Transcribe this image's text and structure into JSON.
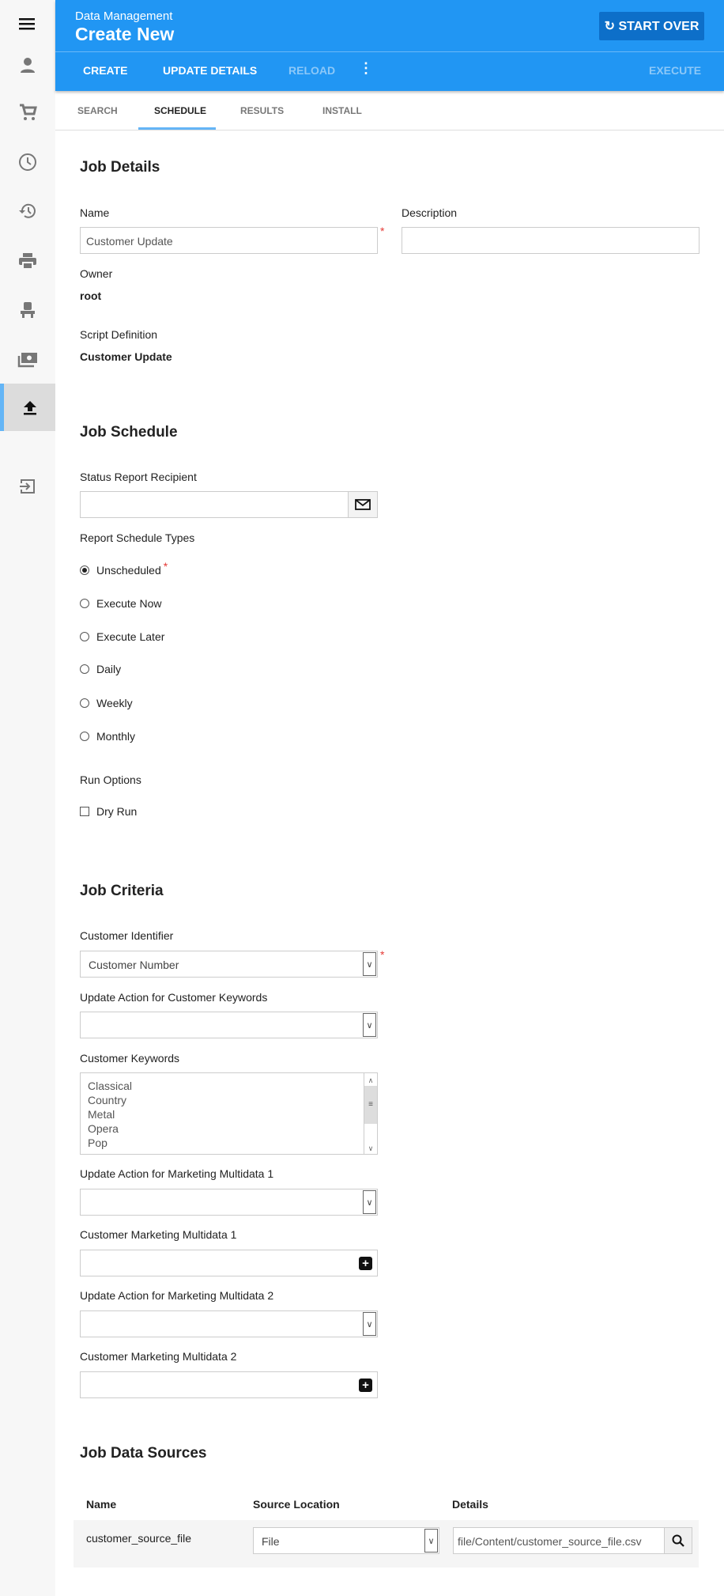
{
  "sidebar": {
    "items": [
      "menu-icon",
      "person-icon",
      "cart-icon",
      "clock-icon",
      "history-icon",
      "print-icon",
      "seat-icon",
      "money-icon",
      "upload-icon",
      "logout-icon"
    ],
    "active": "upload-icon",
    "accent": "#64b5f6"
  },
  "header": {
    "subtitle": "Data Management",
    "title": "Create New",
    "start_over": "START OVER",
    "actions": {
      "create": "CREATE",
      "update": "UPDATE DETAILS",
      "reload": "RELOAD",
      "execute": "EXECUTE"
    },
    "color": "#2196f3"
  },
  "tabs": [
    {
      "label": "SEARCH"
    },
    {
      "label": "SCHEDULE",
      "active": true
    },
    {
      "label": "RESULTS"
    },
    {
      "label": "INSTALL"
    }
  ],
  "job_details": {
    "title": "Job Details",
    "name_label": "Name",
    "name_value": "Customer Update",
    "desc_label": "Description",
    "desc_value": "",
    "owner_label": "Owner",
    "owner_value": "root",
    "script_label": "Script Definition",
    "script_value": "Customer Update",
    "required": "*"
  },
  "job_schedule": {
    "title": "Job Schedule",
    "recipient_label": "Status Report Recipient",
    "recipient_value": "",
    "types_label": "Report Schedule Types",
    "types": [
      "Unscheduled",
      "Execute Now",
      "Execute Later",
      "Daily",
      "Weekly",
      "Monthly"
    ],
    "selected": "Unscheduled",
    "run_options_label": "Run Options",
    "dry_run": "Dry Run",
    "dry_run_checked": false
  },
  "job_criteria": {
    "title": "Job Criteria",
    "identifier_label": "Customer Identifier",
    "identifier_value": "Customer Number",
    "kw_action_label": "Update Action for Customer Keywords",
    "kw_action_value": "",
    "keywords_label": "Customer Keywords",
    "keywords": [
      "Classical",
      "Country",
      "Metal",
      "Opera",
      "Pop"
    ],
    "mm1_action_label": "Update Action for Marketing Multidata 1",
    "mm1_label": "Customer Marketing Multidata 1",
    "mm2_action_label": "Update Action for Marketing Multidata 2",
    "mm2_label": "Customer Marketing Multidata 2"
  },
  "data_sources": {
    "title": "Job Data Sources",
    "columns": [
      "Name",
      "Source Location",
      "Details"
    ],
    "rows": [
      {
        "name": "customer_source_file",
        "location": "File",
        "details": "file/Content/customer_source_file.csv"
      }
    ]
  }
}
